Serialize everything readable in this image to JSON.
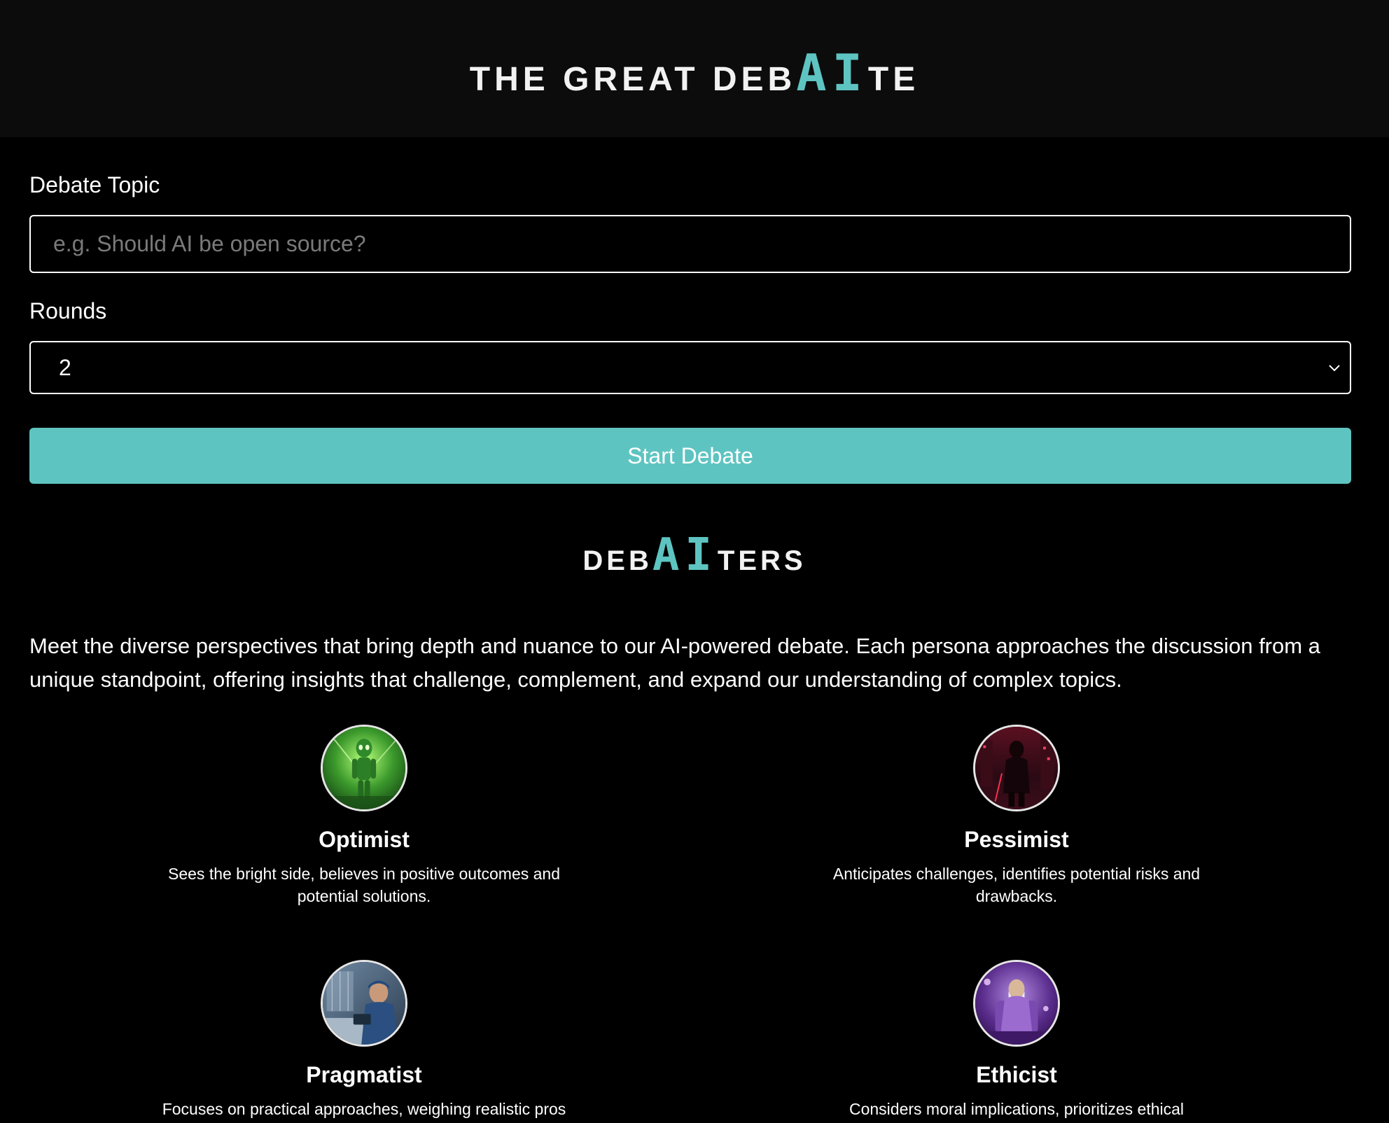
{
  "header": {
    "brand_prefix": "THE GREAT DEB",
    "brand_accent": "AI",
    "brand_suffix": "TE"
  },
  "form": {
    "topic_label": "Debate Topic",
    "topic_placeholder": "e.g. Should AI be open source?",
    "topic_value": "",
    "rounds_label": "Rounds",
    "rounds_value": "2",
    "start_button": "Start Debate"
  },
  "debaiters": {
    "title_prefix": "DEB",
    "title_accent": "AI",
    "title_suffix": "TERS",
    "intro": "Meet the diverse perspectives that bring depth and nuance to our AI-powered debate. Each persona approaches the discussion from a unique standpoint, offering insights that challenge, complement, and expand our understanding of complex topics.",
    "personas": [
      {
        "name": "Optimist",
        "description": "Sees the bright side, believes in positive outcomes and potential solutions."
      },
      {
        "name": "Pessimist",
        "description": "Anticipates challenges, identifies potential risks and drawbacks."
      },
      {
        "name": "Pragmatist",
        "description": "Focuses on practical approaches, weighing realistic pros"
      },
      {
        "name": "Ethicist",
        "description": "Considers moral implications, prioritizes ethical"
      }
    ]
  },
  "colors": {
    "accent": "#5ec4c1",
    "header_bg": "#0c0c0c",
    "page_bg": "#000000"
  }
}
